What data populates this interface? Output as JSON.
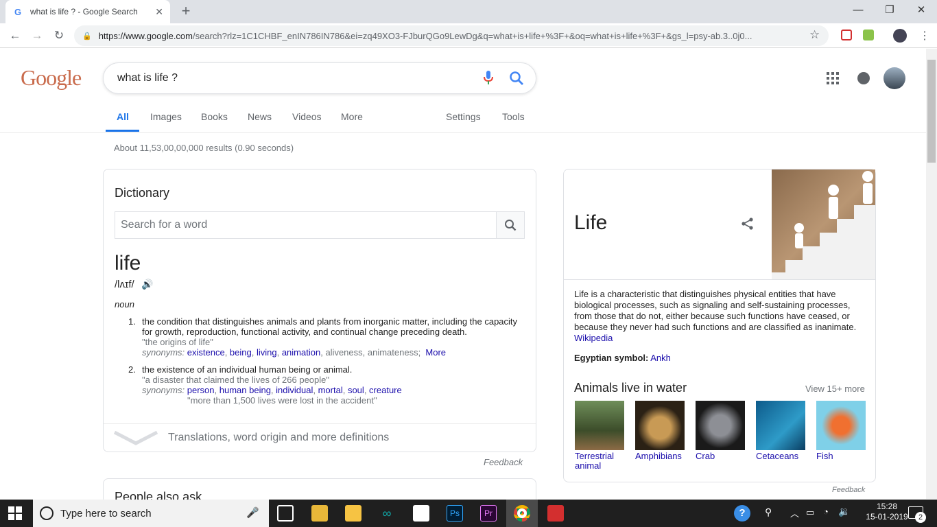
{
  "browser": {
    "tab_title": "what is life ? - Google Search",
    "tab_favicon": "G",
    "new_tab": "+",
    "url_host": "https://www.google.com",
    "url_rest": "/search?rlz=1C1CHBF_enIN786IN786&ei=zq49XO3-FJburQGo9LewDg&q=what+is+life+%3F+&oq=what+is+life+%3F+&gs_l=psy-ab.3..0j0..."
  },
  "google": {
    "logo": "Google",
    "query": "what is life ?",
    "tabs": [
      "All",
      "Images",
      "Books",
      "News",
      "Videos",
      "More"
    ],
    "settings": "Settings",
    "tools": "Tools",
    "stats": "About 11,53,00,00,000 results (0.90 seconds)"
  },
  "dictionary": {
    "title": "Dictionary",
    "search_placeholder": "Search for a word",
    "word": "life",
    "phonetic": "/lʌɪf/",
    "pos": "noun",
    "def1": {
      "num": "1.",
      "text": "the condition that distinguishes animals and plants from inorganic matter, including the capacity for growth, reproduction, functional activity, and continual change preceding death.",
      "example": "\"the origins of life\"",
      "syn_label": "synonyms:",
      "syn_links": [
        "existence",
        "being",
        "living",
        "animation"
      ],
      "syn_plain": "aliveness, animateness;",
      "more": "More"
    },
    "def2": {
      "num": "2.",
      "text": "the existence of an individual human being or animal.",
      "example": "\"a disaster that claimed the lives of 266 people\"",
      "syn_label": "synonyms:",
      "syn_links": [
        "person",
        "human being",
        "individual",
        "mortal",
        "soul",
        "creature"
      ],
      "example2": "\"more than 1,500 lives were lost in the accident\""
    },
    "more_defs": "Translations, word origin and more definitions",
    "feedback": "Feedback"
  },
  "paa": {
    "title": "People also ask"
  },
  "knowledge_panel": {
    "title": "Life",
    "description": "Life is a characteristic that distinguishes physical entities that have biological processes, such as signaling and self-sustaining processes, from those that do not, either because such functions have ceased, or because they never had such functions and are classified as inanimate.",
    "wiki": "Wikipedia",
    "fact_label": "Egyptian symbol:",
    "fact_value": "Ankh",
    "animals_title": "Animals live in water",
    "view_more": "View 15+ more",
    "animals": [
      "Terrestrial animal",
      "Amphibians",
      "Crab",
      "Cetaceans",
      "Fish"
    ],
    "feedback": "Feedback"
  },
  "taskbar": {
    "search_placeholder": "Type here to search",
    "time": "15:28",
    "date": "15-01-2019",
    "notification_count": "2"
  }
}
